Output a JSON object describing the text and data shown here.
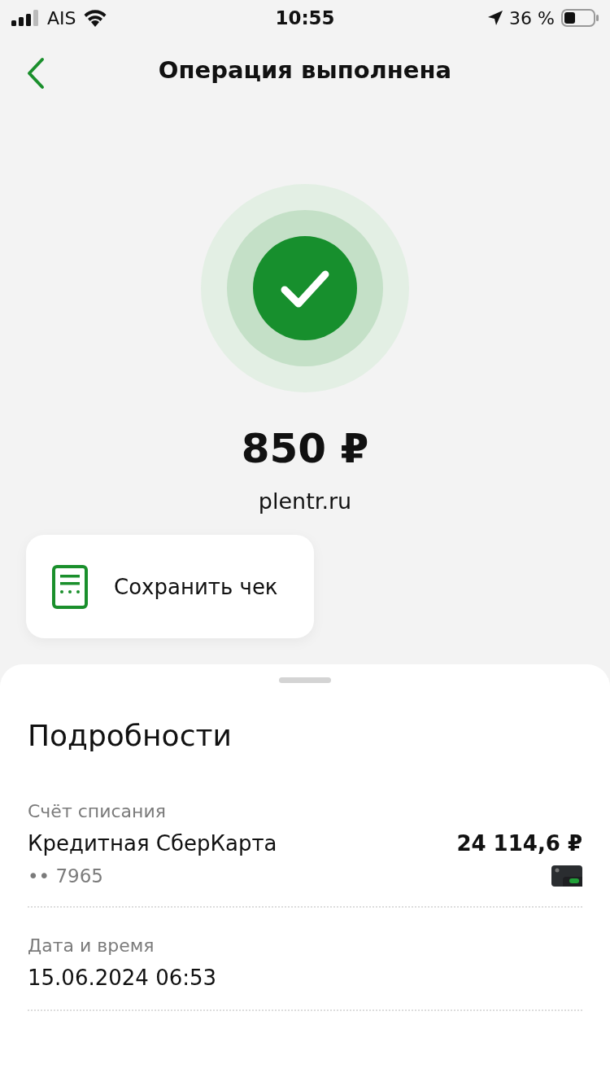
{
  "status_bar": {
    "carrier": "AIS",
    "time": "10:55",
    "battery": "36 %"
  },
  "header": {
    "title": "Операция выполнена"
  },
  "result": {
    "amount": "850 ₽",
    "merchant": "plentr.ru"
  },
  "save_button": {
    "label": "Сохранить чек"
  },
  "details": {
    "title": "Подробности",
    "fields": [
      {
        "kind": "account",
        "label": "Счёт списания",
        "value": "Кредитная СберКарта",
        "sub": "•• 7965",
        "amount": "24 114,6 ₽"
      },
      {
        "kind": "plain",
        "label": "Дата и время",
        "value": "15.06.2024 06:53"
      }
    ]
  }
}
